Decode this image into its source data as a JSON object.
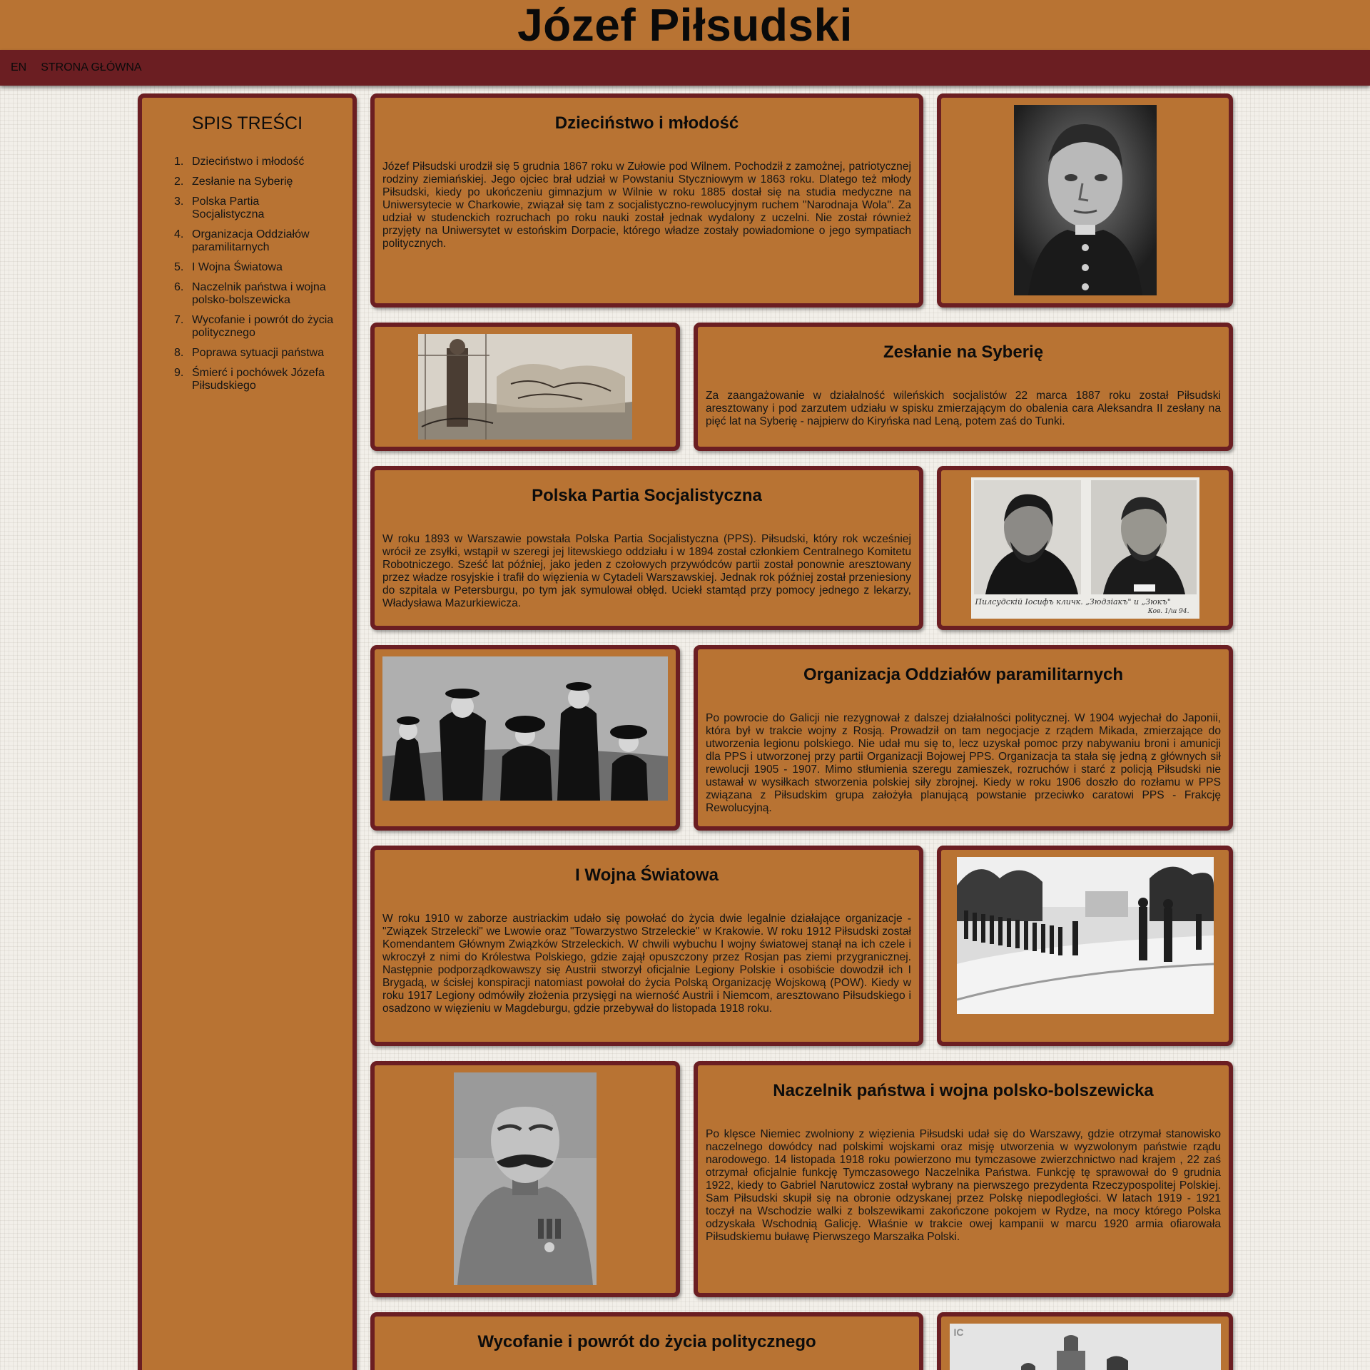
{
  "header": {
    "title": "Józef Piłsudski"
  },
  "nav": {
    "lang_link": "EN",
    "home_link": "STRONA GŁÓWNA"
  },
  "toc": {
    "title": "SPIS TREŚCI",
    "items": [
      {
        "num": "1.",
        "label": "Dzieciństwo i młodość"
      },
      {
        "num": "2.",
        "label": "Zesłanie na Syberię"
      },
      {
        "num": "3.",
        "label": "Polska Partia Socjalistyczna"
      },
      {
        "num": "4.",
        "label": "Organizacja Oddziałów paramilitarnych"
      },
      {
        "num": "5.",
        "label": "I Wojna Światowa"
      },
      {
        "num": "6.",
        "label": "Naczelnik państwa i wojna polsko-bolszewicka"
      },
      {
        "num": "7.",
        "label": "Wycofanie i powrót do życia politycznego"
      },
      {
        "num": "8.",
        "label": "Poprawa sytuacji państwa"
      },
      {
        "num": "9.",
        "label": "Śmierć i pochówek Józefa Piłsudskiego"
      }
    ]
  },
  "sections": {
    "s1": {
      "title": "Dzieciństwo i młodość",
      "text": "Józef Piłsudski urodził się 5 grudnia 1867 roku w Zułowie pod Wilnem. Pochodził z zamożnej, patriotycznej rodziny ziemiańskiej. Jego ojciec brał udział w Powstaniu Styczniowym w 1863 roku. Dlatego też młody Piłsudski, kiedy po ukończeniu gimnazjum w Wilnie w roku 1885 dostał się na studia medyczne na Uniwersytecie w Charkowie, związał się tam z socjalistyczno-rewolucyjnym ruchem \"Narodnaja Wola\". Za udział w studenckich rozruchach po roku nauki został jednak wydalony z uczelni. Nie został również przyjęty na Uniwersytet w estońskim Dorpacie, którego władze zostały powiadomione o jego sympatiach politycznych."
    },
    "s2": {
      "title": "Zesłanie na Syberię",
      "text": "Za zaangażowanie w działalność wileńskich socjalistów 22 marca 1887 roku został Piłsudski aresztowany i pod zarzutem udziału w spisku zmierzającym do obalenia cara Aleksandra II zesłany na pięć lat na Syberię - najpierw do Kiryńska nad Leną, potem zaś do Tunki."
    },
    "s3": {
      "title": "Polska Partia Socjalistyczna",
      "text": "W roku 1893 w Warszawie powstała Polska Partia Socjalistyczna (PPS). Piłsudski, który rok wcześniej wrócił ze zsyłki, wstąpił w szeregi jej litewskiego oddziału i w 1894 został członkiem Centralnego Komitetu Robotniczego. Sześć lat później, jako jeden z czołowych przywódców partii został ponownie aresztowany przez władze rosyjskie i trafił do więzienia w Cytadeli Warszawskiej. Jednak rok później został przeniesiony do szpitala w Petersburgu, po tym jak symulował obłęd. Uciekł stamtąd przy pomocy jednego z lekarzy, Władysława Mazurkiewicza.",
      "photo_caption": "Пилсудскiй Іосифъ кличк. „Зюдзiакъ\" и „Зюкъ\"",
      "photo_caption2": "Ков. 1/ш 94."
    },
    "s4": {
      "title": "Organizacja Oddziałów paramilitarnych",
      "text": "Po powrocie do Galicji nie rezygnował z dalszej działalności politycznej. W 1904 wyjechał do Japonii, która był w trakcie wojny z Rosją. Prowadził on tam negocjacje z rządem Mikada, zmierzające do utworzenia legionu polskiego. Nie udał mu się to, lecz uzyskał pomoc przy nabywaniu broni i amunicji dla PPS i utworzonej przy partii Organizacji Bojowej PPS. Organizacja ta stała się jedną z głównych sił rewolucji 1905 - 1907. Mimo stłumienia szeregu zamieszek, rozruchów i starć z policją Piłsudski nie ustawał w wysiłkach stworzenia polskiej siły zbrojnej. Kiedy w roku 1906 doszło do rozłamu w PPS związana z Piłsudskim grupa założyła planującą powstanie przeciwko caratowi PPS - Frakcję Rewolucyjną."
    },
    "s5": {
      "title": "I Wojna Światowa",
      "text": "W roku 1910 w zaborze austriackim udało się powołać do życia dwie legalnie działające organizacje - \"Związek Strzelecki\" we Lwowie oraz \"Towarzystwo Strzeleckie\" w Krakowie. W roku 1912 Piłsudski został Komendantem Głównym Związków Strzeleckich. W chwili wybuchu I wojny światowej stanął na ich czele i wkroczył z nimi do Królestwa Polskiego, gdzie zajął opuszczony przez Rosjan pas ziemi przygranicznej. Następnie podporządkowawszy się Austrii stworzył oficjalnie Legiony Polskie i osobiście dowodził ich I Brygadą, w ścisłej konspiracji natomiast powołał do życia Polską Organizację Wojskową (POW). Kiedy w roku 1917 Legiony odmówiły złożenia przysięgi na wierność Austrii i Niemcom, aresztowano Piłsudskiego i osadzono w więzieniu w Magdeburgu, gdzie przebywał do listopada 1918 roku."
    },
    "s6": {
      "title": "Naczelnik państwa i wojna polsko-bolszewicka",
      "text": "Po klęsce Niemiec zwolniony z więzienia Piłsudski udał się do Warszawy, gdzie otrzymał stanowisko naczelnego dowódcy nad polskimi wojskami oraz misję utworzenia w wyzwolonym państwie rządu narodowego. 14 listopada 1918 roku powierzono mu tymczasowe zwierzchnictwo nad krajem , 22 zaś otrzymał oficjalnie funkcję Tymczasowego Naczelnika Państwa. Funkcję tę sprawował do 9 grudnia 1922, kiedy to Gabriel Narutowicz został wybrany na pierwszego prezydenta Rzeczypospolitej Polskiej. Sam Piłsudski skupił się na obronie odzyskanej przez Polskę niepodległości. W latach 1919 - 1921 toczył na Wschodzie walki z bolszewikami zakończone pokojem w Rydze, na mocy którego Polska odzyskała Wschodnią Galicję. Właśnie w trakcie owej kampanii w marcu 1920 armia ofiarowała Piłsudskiemu buławę Pierwszego Marszałka Polski."
    },
    "s7": {
      "title": "Wycofanie i powrót do życia politycznego",
      "photo_mark": "IC"
    }
  },
  "colors": {
    "panel": "#b87333",
    "border": "#6b1e22",
    "navbar": "#6b1e22",
    "page_bg": "#f2efe9"
  }
}
